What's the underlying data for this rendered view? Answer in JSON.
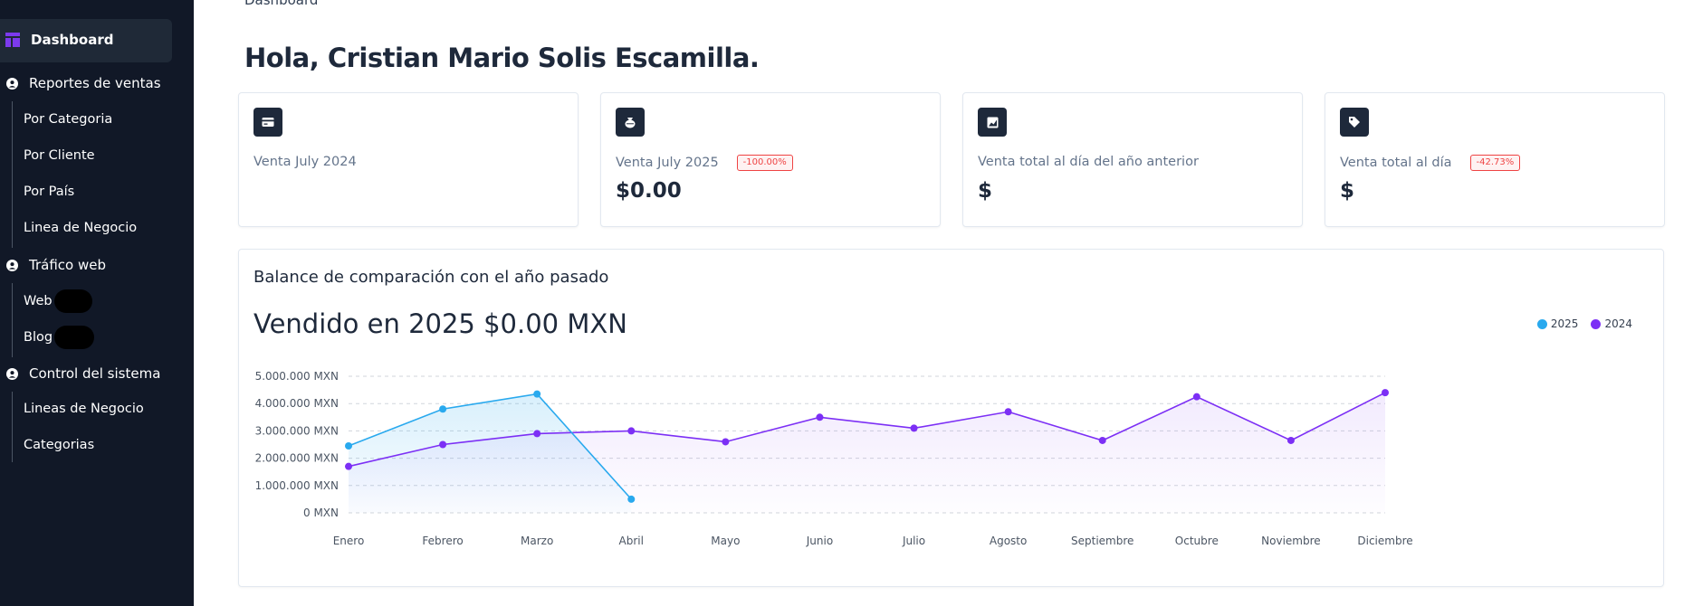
{
  "sidebar": {
    "dashboard": "Dashboard",
    "sections": [
      {
        "label": "Reportes de ventas",
        "items": [
          "Por Categoria",
          "Por Cliente",
          "Por País",
          "Linea de Negocio"
        ]
      },
      {
        "label": "Tráfico web",
        "items": [
          "Web",
          "Blog"
        ]
      },
      {
        "label": "Control del sistema",
        "items": [
          "Lineas de Negocio",
          "Categorias"
        ]
      }
    ]
  },
  "breadcrumb": "Dashboard",
  "greeting": "Hola, Cristian Mario Solis Escamilla.",
  "cards": [
    {
      "label": "Venta July 2024",
      "value": "",
      "icon": "credit-card-icon"
    },
    {
      "label": "Venta July 2025",
      "badge": "-100.00%",
      "value": "$0.00",
      "icon": "money-bag-icon"
    },
    {
      "label": "Venta total al día del año anterior",
      "value": "$",
      "icon": "chart-area-icon"
    },
    {
      "label": "Venta total al día",
      "badge": "-42.73%",
      "value": "$",
      "icon": "tag-icon"
    }
  ],
  "chart": {
    "title": "Balance de comparación con el año pasado",
    "headline": "Vendido en 2025 $0.00 MXN"
  },
  "colors": {
    "sidebar_bg": "#111827",
    "series_2025": "#29a9ee",
    "series_2024": "#7c2ff5",
    "badge_red": "#ef4444"
  },
  "chart_data": {
    "type": "area",
    "categories": [
      "Enero",
      "Febrero",
      "Marzo",
      "Abril",
      "Mayo",
      "Junio",
      "Julio",
      "Agosto",
      "Septiembre",
      "Octubre",
      "Noviembre",
      "Diciembre"
    ],
    "series": [
      {
        "name": "2025",
        "color": "#29a9ee",
        "values": [
          2450000,
          3800000,
          4350000,
          500000
        ]
      },
      {
        "name": "2024",
        "color": "#7c2ff5",
        "values": [
          1700000,
          2500000,
          2900000,
          3000000,
          2600000,
          3500000,
          3100000,
          3700000,
          2650000,
          4250000,
          2650000,
          4400000
        ]
      }
    ],
    "y_ticks": [
      "0 MXN",
      "1.000.000 MXN",
      "2.000.000 MXN",
      "3.000.000 MXN",
      "4.000.000 MXN",
      "5.000.000 MXN"
    ],
    "ylim": [
      0,
      5000000
    ],
    "grid": true,
    "legend": "top-right"
  }
}
